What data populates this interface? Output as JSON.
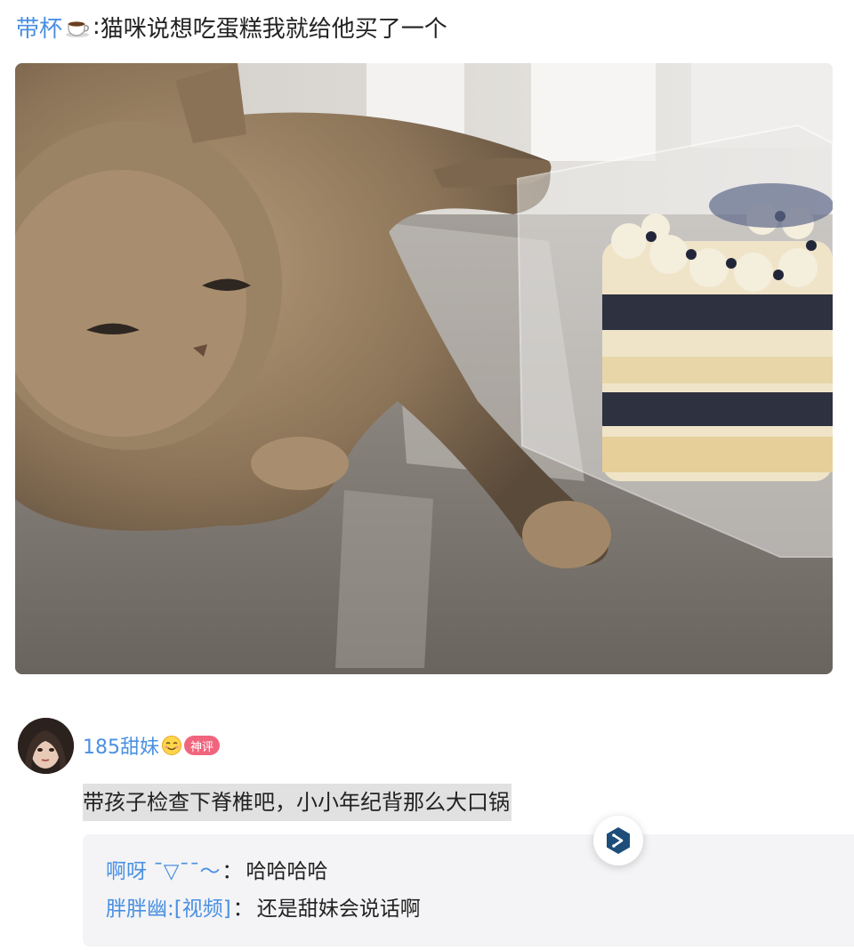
{
  "post": {
    "author": "带杯",
    "author_icon": "coffee-cup-icon",
    "separator": ":",
    "text": "猫咪说想吃蛋糕我就给他买了一个",
    "photo": "cat-with-cake-photo"
  },
  "comment": {
    "avatar": "user-avatar",
    "username": "185甜妹",
    "username_icon": "smiley-emoji-icon",
    "badge": "神评",
    "text": "带孩子检查下脊椎吧，小小年纪背那么大口锅"
  },
  "replies": [
    {
      "user": "啊呀 ˉ▽ˉˉ～",
      "separator": "：",
      "text": "哈哈哈哈"
    },
    {
      "user": "胖胖幽:[视频]",
      "separator": "：",
      "text": "还是甜妹会说话啊"
    }
  ],
  "float_button": {
    "icon": "share-hexagon-icon"
  },
  "colors": {
    "link_blue": "#4a90e2",
    "badge_pink": "#f0657d",
    "highlight_gray": "#e1e1e1",
    "reply_bg": "#f4f4f6",
    "button_icon": "#1d4e7a"
  }
}
